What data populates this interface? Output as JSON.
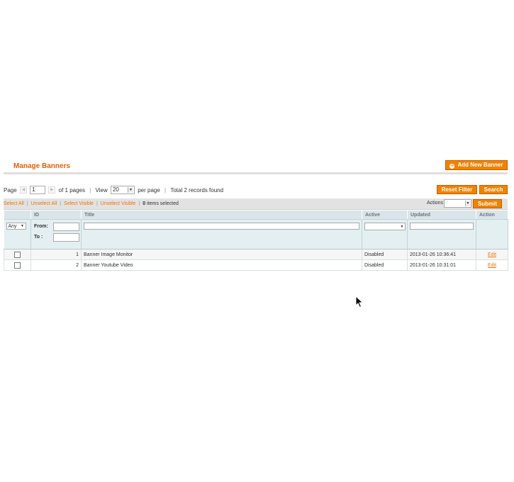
{
  "header": {
    "title": "Manage Banners",
    "add_button": "Add New Banner"
  },
  "pager": {
    "page_label": "Page",
    "page_value": "1",
    "of_pages": "of 1 pages",
    "view_label": "View",
    "per_page_value": "20",
    "per_page_label": "per page",
    "total": "Total 2 records found",
    "reset_button": "Reset Filter",
    "search_button": "Search"
  },
  "massaction": {
    "select_all": "Select All",
    "unselect_all": "Unselect All",
    "select_visible": "Select Visible",
    "unselect_visible": "Unselect Visible",
    "selected_count": "0",
    "selected_label": "items selected",
    "actions_label": "Actions",
    "submit_button": "Submit"
  },
  "grid": {
    "columns": {
      "id": "ID",
      "title": "Title",
      "active": "Active",
      "updated": "Updated",
      "action": "Action"
    },
    "filter": {
      "any": "Any",
      "from": "From:",
      "to": "To :"
    },
    "rows": [
      {
        "id": "1",
        "title": "Banner Image Monitor",
        "active": "Disabled",
        "updated": "2013-01-26 10:36:41",
        "action": "Edit"
      },
      {
        "id": "2",
        "title": "Banner Youtube Video",
        "active": "Disabled",
        "updated": "2013-01-26 10:31:01",
        "action": "Edit"
      }
    ]
  },
  "colors": {
    "accent": "#eb5e00",
    "button": "#f18200",
    "header_bg": "#d9e5e9",
    "filter_bg": "#e3eff1"
  }
}
